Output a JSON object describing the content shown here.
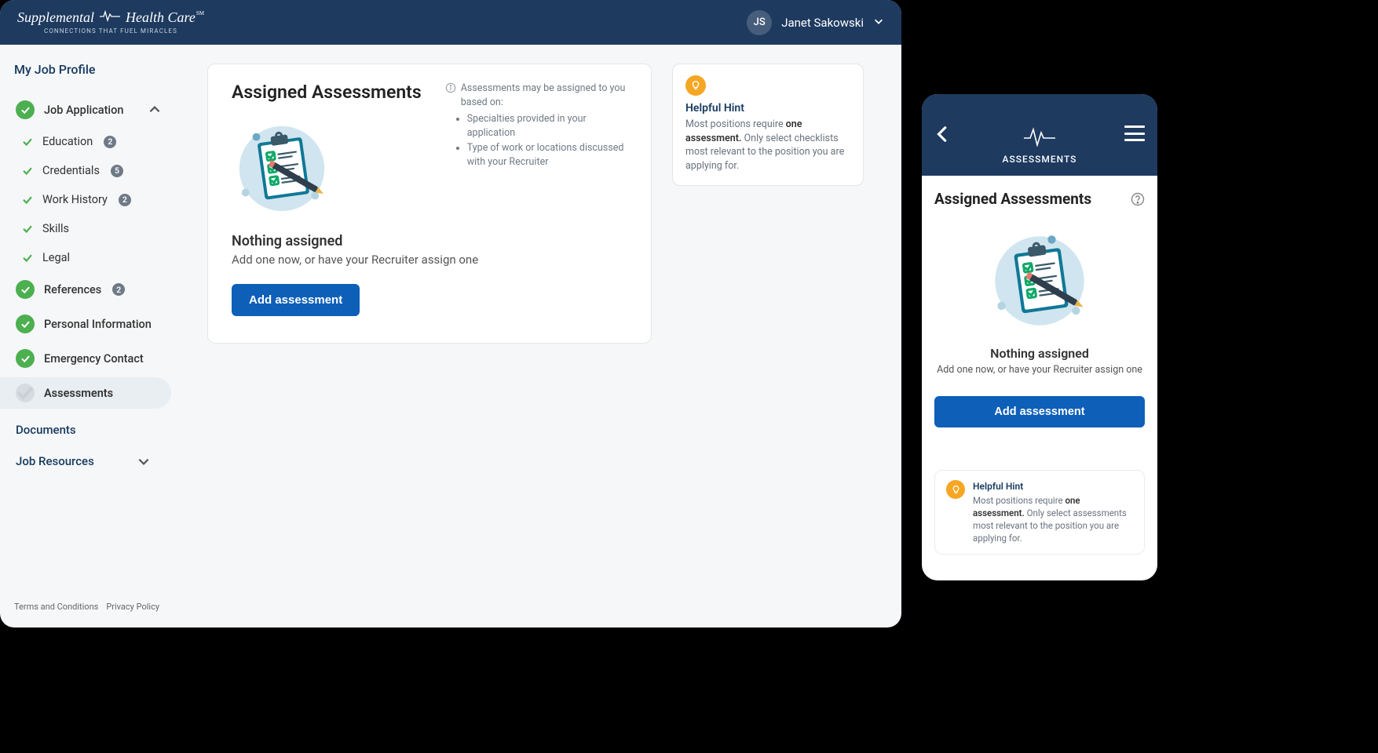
{
  "brand": {
    "line1a": "Supplemental",
    "line1b": "Health Care",
    "tagline": "CONNECTIONS THAT FUEL MIRACLES"
  },
  "user": {
    "initials": "JS",
    "name": "Janet Sakowski"
  },
  "sidebar": {
    "title": "My Job Profile",
    "items": [
      {
        "label": "Job Application",
        "icon": "circle-check",
        "level": 1,
        "expand": true
      },
      {
        "label": "Education",
        "icon": "check",
        "level": 2,
        "badge": "2"
      },
      {
        "label": "Credentials",
        "icon": "check",
        "level": 2,
        "badge": "5"
      },
      {
        "label": "Work History",
        "icon": "check",
        "level": 2,
        "badge": "2"
      },
      {
        "label": "Skills",
        "icon": "check",
        "level": 2
      },
      {
        "label": "Legal",
        "icon": "check",
        "level": 2
      },
      {
        "label": "References",
        "icon": "circle-check",
        "level": 1,
        "badge": "2"
      },
      {
        "label": "Personal Information",
        "icon": "circle-check",
        "level": 1
      },
      {
        "label": "Emergency Contact",
        "icon": "circle-check",
        "level": 1
      },
      {
        "label": "Assessments",
        "icon": "circle-grey",
        "level": 1,
        "active": true
      }
    ],
    "sections": [
      {
        "label": "Documents"
      },
      {
        "label": "Job Resources",
        "chevron": true
      }
    ],
    "footer": {
      "terms": "Terms and Conditions",
      "privacy": "Privacy Policy"
    }
  },
  "main": {
    "title": "Assigned Assessments",
    "info_lead": "Assessments may be assigned to you based on:",
    "info_items": [
      "Specialties provided in your application",
      "Type of work or locations discussed with your Recruiter"
    ],
    "empty_title": "Nothing assigned",
    "empty_sub": "Add one now, or have your Recruiter assign one",
    "add_btn": "Add assessment"
  },
  "hint": {
    "title": "Helpful Hint",
    "text_pre": "Most positions require ",
    "text_bold": "one assessment.",
    "text_post_desktop": " Only select checklists most relevant to the position you are applying for.",
    "text_post_mobile": " Only select assessments most relevant to the position you are applying for."
  },
  "mobile": {
    "header_title": "ASSESSMENTS",
    "heading": "Assigned Assessments",
    "empty_title": "Nothing assigned",
    "empty_sub": "Add one now, or have your Recruiter assign one",
    "add_btn": "Add assessment"
  }
}
